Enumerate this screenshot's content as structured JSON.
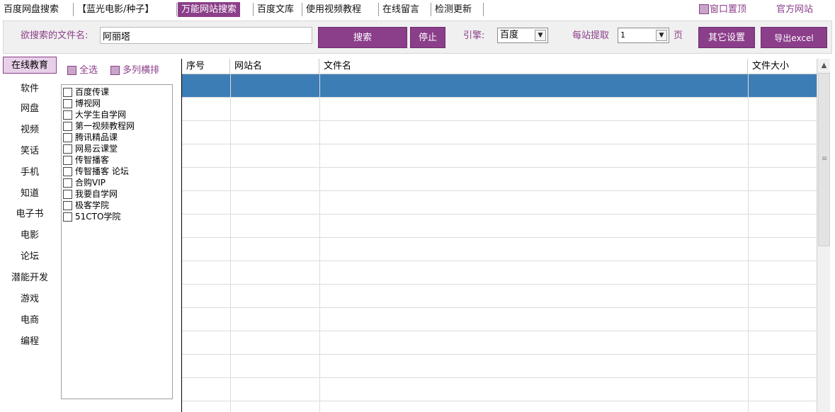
{
  "menubar": {
    "items": [
      {
        "label": "百度网盘搜索",
        "active": false
      },
      {
        "label": "【蓝光电影/种子】",
        "active": false
      },
      {
        "label": "万能网站搜索",
        "active": true
      },
      {
        "label": "百度文库",
        "active": false
      },
      {
        "label": "使用视频教程",
        "active": false
      },
      {
        "label": "在线留言",
        "active": false
      },
      {
        "label": "检测更新",
        "active": false
      }
    ],
    "pin_top_label": "窗口置顶",
    "official_label": "官方网站"
  },
  "search": {
    "label": "欲搜索的文件名:",
    "value": "阿丽塔",
    "search_button": "搜索",
    "stop_button": "停止",
    "engine_label": "引擎:",
    "engine_value": "百度",
    "per_site_label": "每站提取",
    "per_site_value": "1",
    "page_label": "页",
    "other_settings_button": "其它设置",
    "export_button": "导出excel"
  },
  "categories": [
    {
      "label": "在线教育",
      "active": true
    },
    {
      "label": "软件",
      "active": false
    },
    {
      "label": "网盘",
      "active": false
    },
    {
      "label": "视频",
      "active": false
    },
    {
      "label": "笑话",
      "active": false
    },
    {
      "label": "手机",
      "active": false
    },
    {
      "label": "知道",
      "active": false
    },
    {
      "label": "电子书",
      "active": false
    },
    {
      "label": "电影",
      "active": false
    },
    {
      "label": "论坛",
      "active": false
    },
    {
      "label": "潜能开发",
      "active": false
    },
    {
      "label": "游戏",
      "active": false
    },
    {
      "label": "电商",
      "active": false
    },
    {
      "label": "编程",
      "active": false
    }
  ],
  "sites": {
    "select_all_label": "全选",
    "multi_column_label": "多列横排",
    "items": [
      "百度传课",
      "博视网",
      "大学生自学网",
      "第一视频教程网",
      "腾讯精品课",
      "网易云课堂",
      "传智播客",
      "传智播客 论坛",
      "合购VIP",
      "我要自学网",
      "极客学院",
      "51CTO学院"
    ]
  },
  "results": {
    "columns": [
      "序号",
      "网站名",
      "文件名",
      "文件大小"
    ],
    "rows": []
  },
  "colors": {
    "accent": "#8b3e8a",
    "selection": "#3d7db5"
  }
}
